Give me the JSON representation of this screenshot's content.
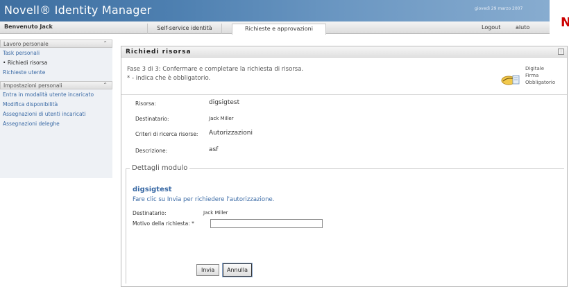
{
  "header": {
    "brand": "Novell® Identity Manager",
    "date": "giovedì 29 marzo 2007",
    "logo": "N"
  },
  "nav": {
    "welcome": "Benvenuto Jack",
    "tabs": [
      {
        "label": "Self-service identità",
        "active": false
      },
      {
        "label": "Richieste e approvazioni",
        "active": true
      }
    ],
    "logout": "Logout",
    "help": "aiuto"
  },
  "sidebar": {
    "sections": [
      {
        "title": "Lavoro personale",
        "items": [
          {
            "label": "Task personali",
            "current": false
          },
          {
            "label": "Richiedi risorsa",
            "current": true
          },
          {
            "label": "Richieste utente",
            "current": false
          }
        ]
      },
      {
        "title": "Impostazioni personali",
        "items": [
          {
            "label": "Entra in modalità utente incaricato",
            "current": false
          },
          {
            "label": "Modifica disponibilità",
            "current": false
          },
          {
            "label": "Assegnazioni di utenti incaricati",
            "current": false
          },
          {
            "label": "Assegnazioni deleghe",
            "current": false
          }
        ]
      }
    ]
  },
  "panel": {
    "title": "Richiedi risorsa",
    "step": "Fase 3 di 3: Confermare e completare la richiesta di risorsa.",
    "required_note": "* - indica che è obbligatorio.",
    "signature": [
      "Digitale",
      "Firma",
      "Obbligatorio"
    ],
    "summary": [
      {
        "label": "Risorsa:",
        "value": "digsigtest"
      },
      {
        "label": "Destinatario:",
        "value": "Jack Miller"
      },
      {
        "label": "Criteri di ricerca risorse:",
        "value": "Autorizzazioni"
      },
      {
        "label": "Descrizione:",
        "value": "asf"
      }
    ],
    "details": {
      "legend": "Dettagli modulo",
      "form_title": "digsigtest",
      "message": "Fare clic su Invia per richiedere l'autorizzazione.",
      "recipient_label": "Destinatario:",
      "recipient_value": "Jack Miller",
      "reason_label": "Motivo della richiesta:",
      "required_mark": "*",
      "reason_value": ""
    },
    "buttons": {
      "submit": "Invia",
      "cancel": "Annulla"
    }
  }
}
